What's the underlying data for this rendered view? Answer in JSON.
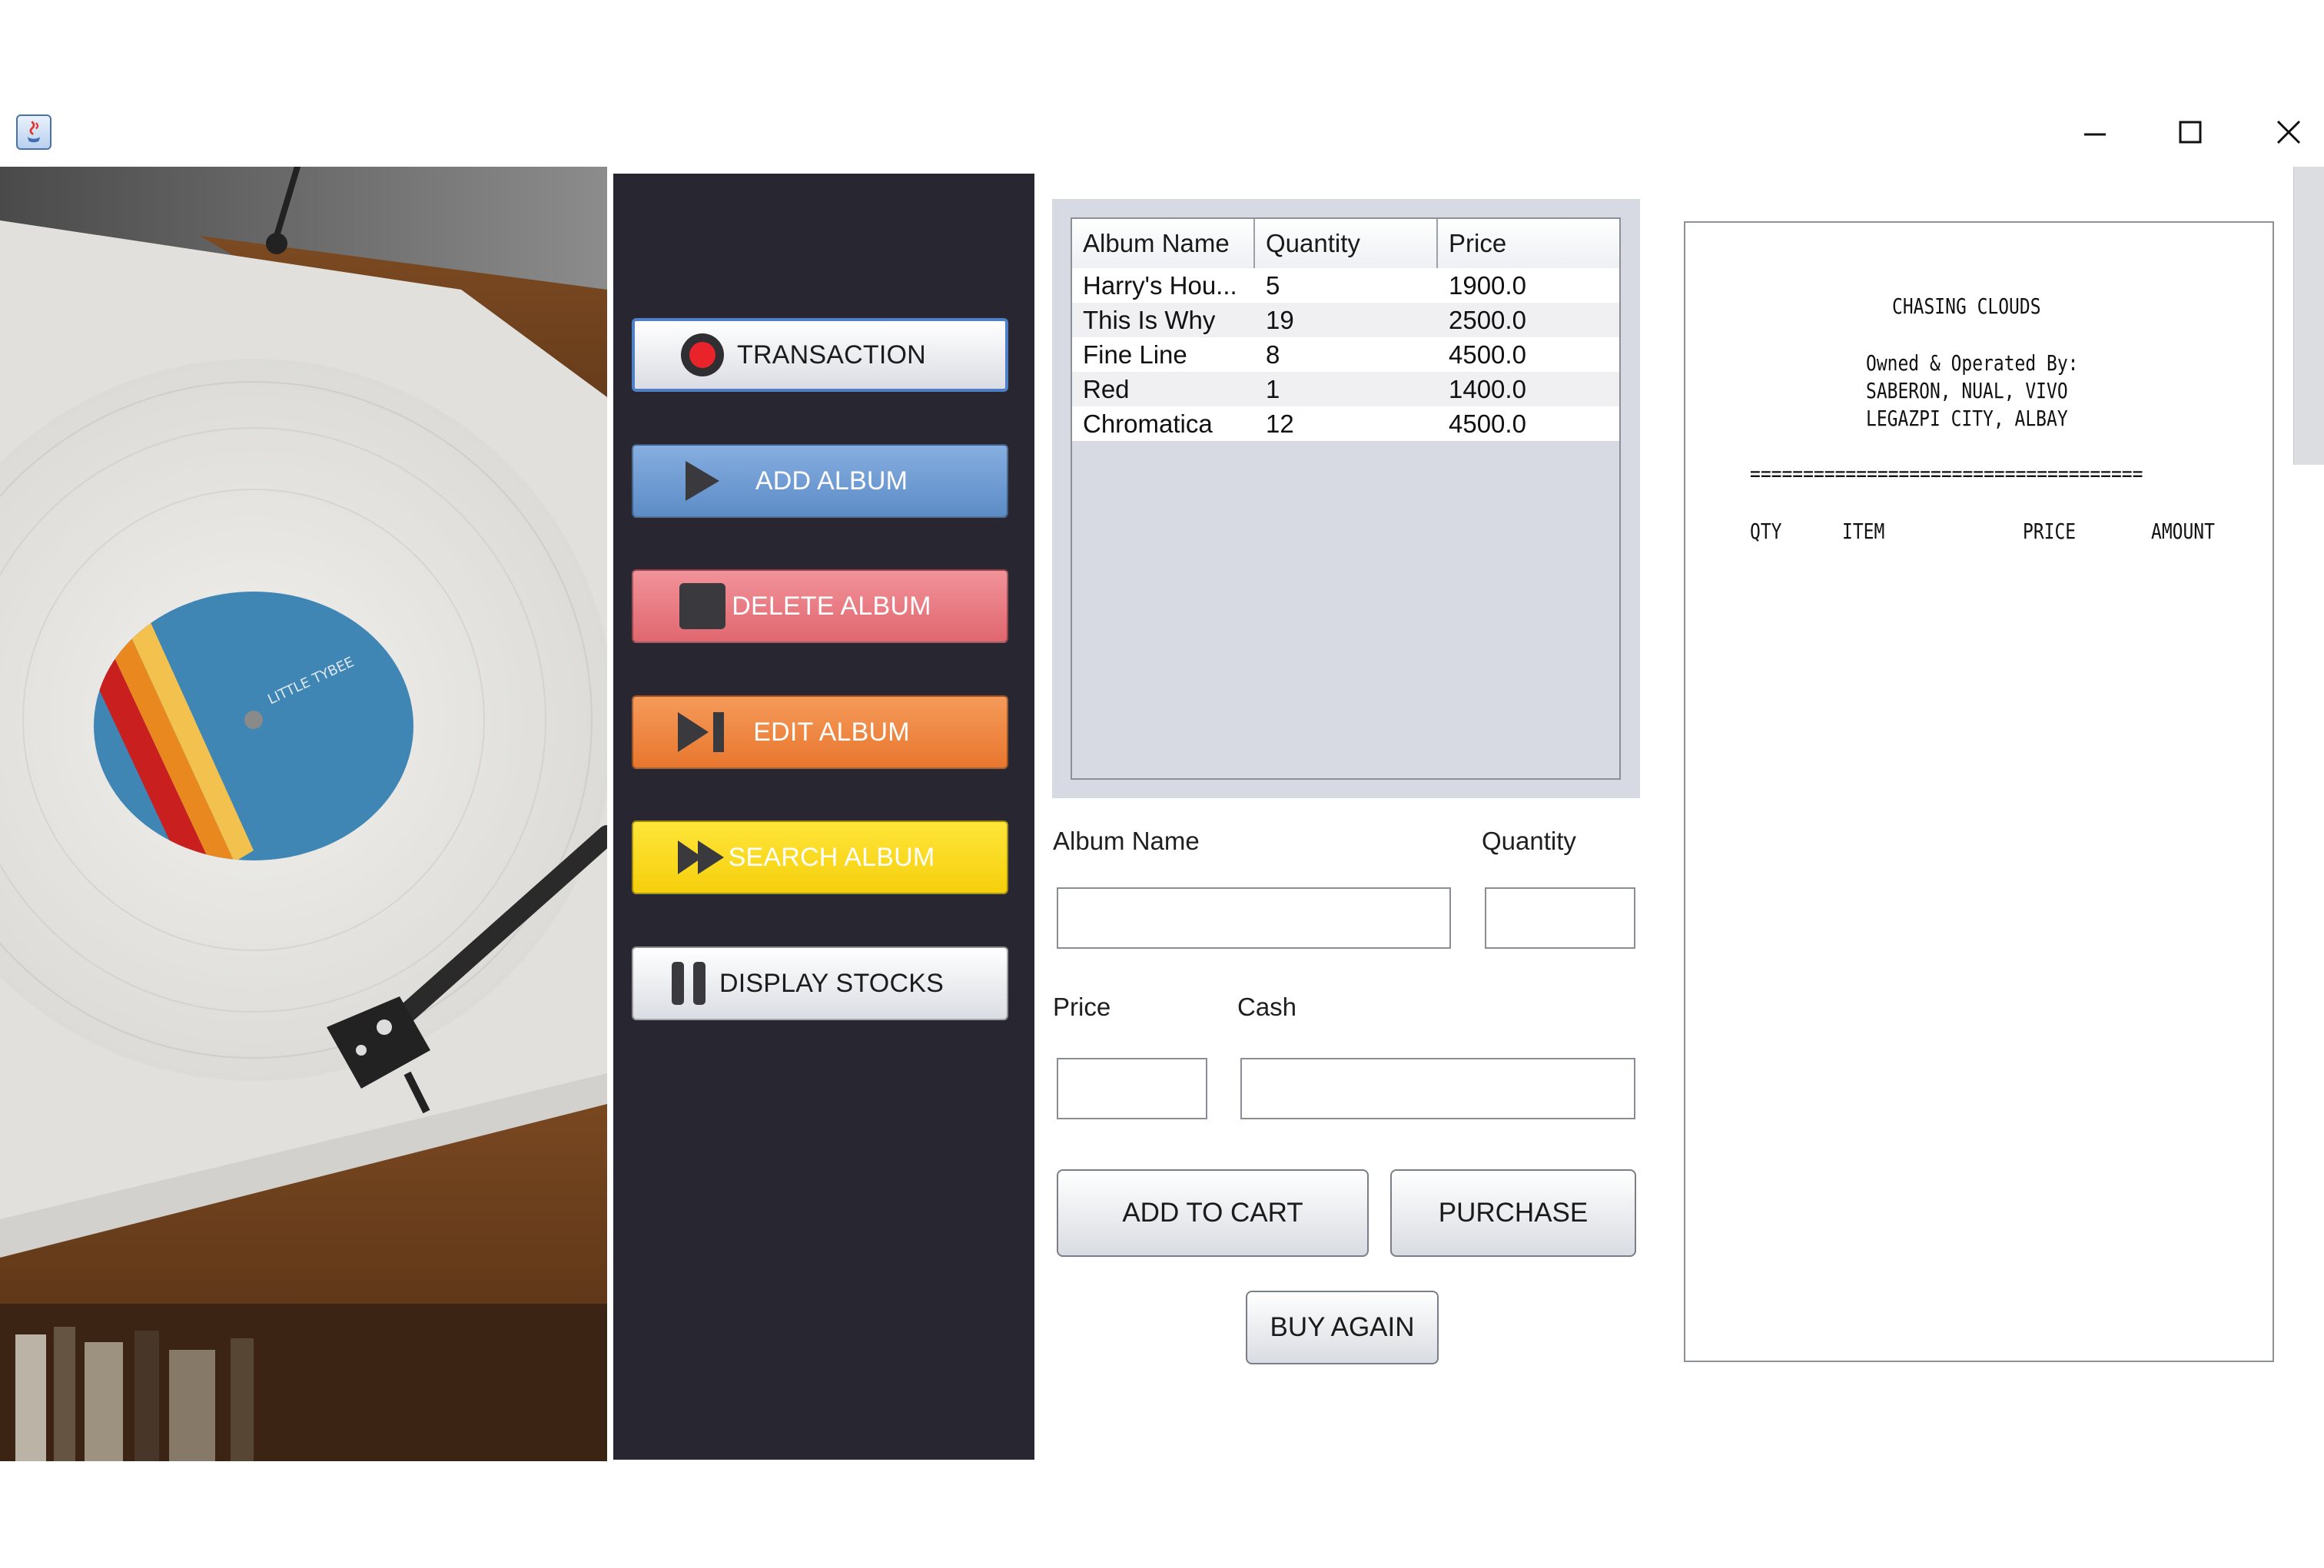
{
  "nav": {
    "transaction": "TRANSACTION",
    "add_album": "ADD ALBUM",
    "delete_album": "DELETE ALBUM",
    "edit_album": "EDIT ALBUM",
    "search_album": "SEARCH ALBUM",
    "display_stocks": "DISPLAY STOCKS"
  },
  "table": {
    "headers": [
      "Album Name",
      "Quantity",
      "Price"
    ],
    "rows": [
      [
        "Harry's Hou...",
        "5",
        "1900.0"
      ],
      [
        "This Is Why",
        "19",
        "2500.0"
      ],
      [
        "Fine Line",
        "8",
        "4500.0"
      ],
      [
        "Red",
        "1",
        "1400.0"
      ],
      [
        "Chromatica",
        "12",
        "4500.0"
      ]
    ]
  },
  "form": {
    "album_name_label": "Album Name",
    "quantity_label": "Quantity",
    "price_label": "Price",
    "cash_label": "Cash",
    "album_name_value": "",
    "quantity_value": "",
    "price_value": "",
    "cash_value": "",
    "add_to_cart": "ADD TO CART",
    "purchase": "PURCHASE",
    "buy_again": "BUY AGAIN"
  },
  "receipt": {
    "store_name": "CHASING CLOUDS",
    "owned_by_label": "Owned & Operated By:",
    "owners": "SABERON, NUAL, VIVO",
    "location": "LEGAZPI CITY, ALBAY",
    "divider": "=====================================",
    "col_qty": "QTY",
    "col_item": "ITEM",
    "col_price": "PRICE",
    "col_amount": "AMOUNT"
  },
  "photo": {
    "record_label_text": "LITTLE TYBEE"
  },
  "colors": {
    "nav_background": "#282631",
    "add_album": "#6f9bd4",
    "delete_album": "#ea7c84",
    "edit_album": "#ee8843",
    "search_album": "#fbdc1f",
    "table_panel": "#d7dae2"
  }
}
